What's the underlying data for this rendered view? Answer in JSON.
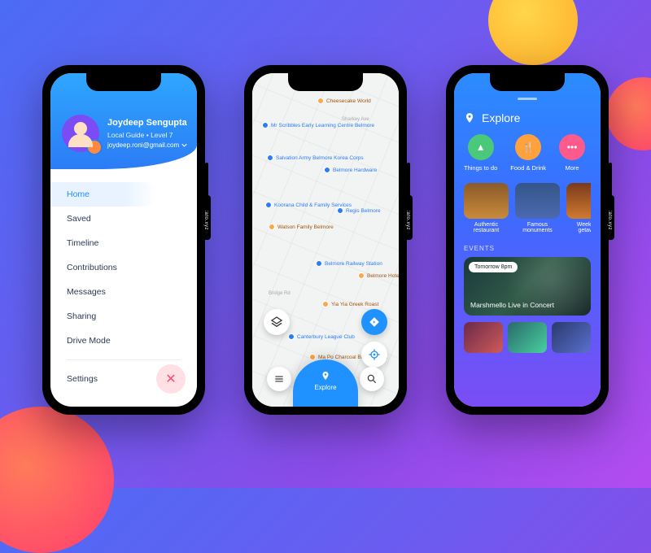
{
  "tag": "rotato.xyz",
  "screen1": {
    "user": {
      "name": "Joydeep Sengupta",
      "subtitle": "Local Guide  •  Level 7",
      "email": "joydeep.roni@gmail.com"
    },
    "menu": [
      "Home",
      "Saved",
      "Timeline",
      "Contributions",
      "Messages",
      "Sharing",
      "Drive Mode"
    ],
    "active_index": 0,
    "secondary": [
      "Settings"
    ],
    "close_glyph": "✕"
  },
  "screen2": {
    "pois": [
      {
        "label": "Cheesecake World",
        "kind": "food"
      },
      {
        "label": "Mr Scribbles Early Learning Centre Belmore",
        "kind": "blue"
      },
      {
        "label": "Salvation Army Belmore Korea Corps",
        "kind": "blue"
      },
      {
        "label": "Belmore Hardware",
        "kind": "blue"
      },
      {
        "label": "Koorana Child & Family Services",
        "kind": "blue"
      },
      {
        "label": "Regis Belmore",
        "kind": "blue"
      },
      {
        "label": "Watson Family Belmore",
        "kind": "food"
      },
      {
        "label": "Belmore Railway Station",
        "kind": "blue"
      },
      {
        "label": "Belmore Hotel",
        "kind": "food"
      },
      {
        "label": "Yia Yia Greek Roast",
        "kind": "food"
      },
      {
        "label": "Canterbury League Club",
        "kind": "blue"
      },
      {
        "label": "Ma Po Charcoal BBQ Korean",
        "kind": "food"
      }
    ],
    "roads": [
      "Bridge Rd",
      "Sharkey Ave"
    ],
    "explore_label": "Explore"
  },
  "screen3": {
    "title": "Explore",
    "categories": [
      {
        "label": "Things to do",
        "color": "c-green",
        "glyph": "▲"
      },
      {
        "label": "Food & Drink",
        "color": "c-orange",
        "glyph": "🍴"
      },
      {
        "label": "More",
        "color": "c-pink",
        "glyph": "•••"
      }
    ],
    "cards": [
      {
        "label": "Authentic restaurant",
        "bg": "linear-gradient(180deg,#8a5a2a,#c98a3a)"
      },
      {
        "label": "Famous monuments",
        "bg": "linear-gradient(180deg,#35558a,#4b6ab0)"
      },
      {
        "label": "Weekend getaway",
        "bg": "linear-gradient(180deg,#7a3a1a,#d07a30)"
      }
    ],
    "events_label": "EVENTS",
    "event": {
      "time": "Tomorrow 8pm",
      "title": "Marshmello Live in Concert"
    }
  }
}
